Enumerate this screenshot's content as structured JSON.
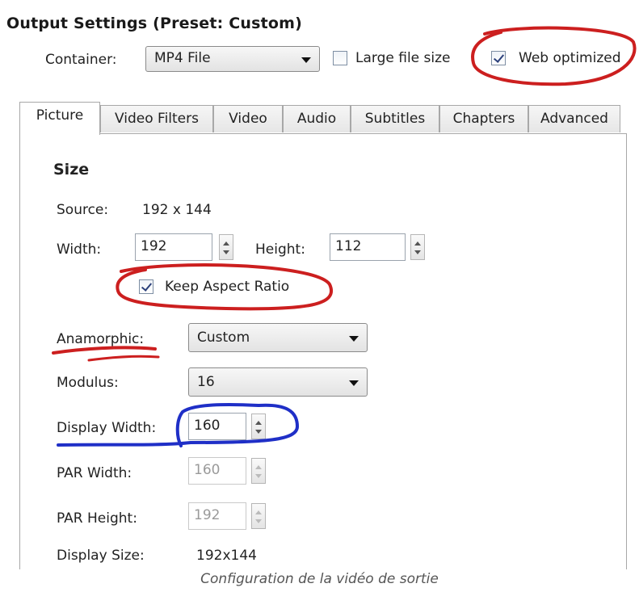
{
  "header": {
    "title": "Output Settings (Preset: Custom)"
  },
  "container": {
    "label": "Container:",
    "value": "MP4 File",
    "large_file_label": "Large file size",
    "large_file_checked": false,
    "web_optimized_label": "Web optimized",
    "web_optimized_checked": true
  },
  "tabs": [
    "Picture",
    "Video Filters",
    "Video",
    "Audio",
    "Subtitles",
    "Chapters",
    "Advanced"
  ],
  "active_tab": "Picture",
  "size": {
    "heading": "Size",
    "source_label": "Source:",
    "source_value": "192 x 144",
    "width_label": "Width:",
    "width_value": "192",
    "height_label": "Height:",
    "height_value": "112",
    "keep_aspect_label": "Keep Aspect Ratio",
    "keep_aspect_checked": true,
    "anamorphic_label": "Anamorphic:",
    "anamorphic_value": "Custom",
    "modulus_label": "Modulus:",
    "modulus_value": "16",
    "display_width_label": "Display Width:",
    "display_width_value": "160",
    "par_width_label": "PAR Width:",
    "par_width_value": "160",
    "par_height_label": "PAR Height:",
    "par_height_value": "192",
    "display_size_label": "Display Size:",
    "display_size_value": "192x144"
  },
  "caption": "Configuration de la vidéo de sortie",
  "annotation_colors": {
    "red": "#cc1f1f",
    "blue": "#1f2fc7"
  }
}
